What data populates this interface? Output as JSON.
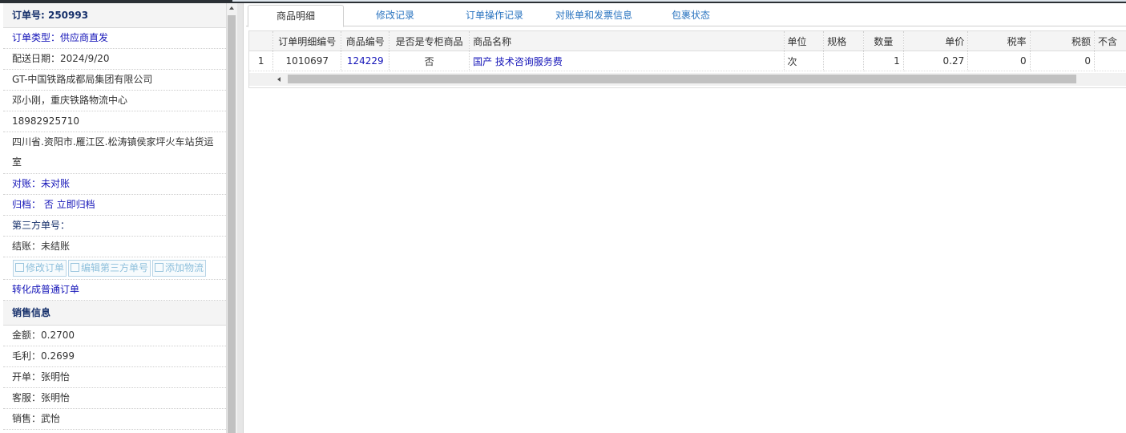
{
  "order": {
    "title": "订单号: 250993",
    "type": "订单类型：供应商直发",
    "delivery_date": "配送日期：2024/9/20",
    "company": "GT-中国铁路成都局集团有限公司",
    "contact": "邓小刚，重庆铁路物流中心",
    "phone": "18982925710",
    "address": "四川省.资阳市.雁江区.松涛镇侯家坪火车站货运室",
    "reconcile": "对账：未对账",
    "archive": "归档： 否 立即归档",
    "third_party": "第三方单号：",
    "settle": "结账：未结账",
    "buttons": [
      "修改订单",
      "编辑第三方单号",
      "添加物流"
    ],
    "convert": "转化成普通订单"
  },
  "sales": {
    "title": "销售信息",
    "amount": "金额：0.2700",
    "profit": "毛利：0.2699",
    "issuer": "开单：张明怡",
    "service": "客服：张明怡",
    "seller": "销售：武怡"
  },
  "tabs": [
    "商品明细",
    "修改记录",
    "订单操作记录",
    "对账单和发票信息",
    "包裹状态"
  ],
  "grid": {
    "columns": [
      "订单明细编号",
      "商品编号",
      "是否是专柜商品",
      "商品名称",
      "单位",
      "规格",
      "数量",
      "单价",
      "税率",
      "税额",
      "不含"
    ],
    "rows": [
      {
        "idx": "1",
        "detail_id": "1010697",
        "product_id": "124229",
        "counter": "否",
        "name": "国产 技术咨询服务费",
        "unit": "次",
        "spec": "",
        "qty": "1",
        "price": "0.27",
        "tax_rate": "0",
        "tax": "0",
        "excl": ""
      }
    ]
  }
}
